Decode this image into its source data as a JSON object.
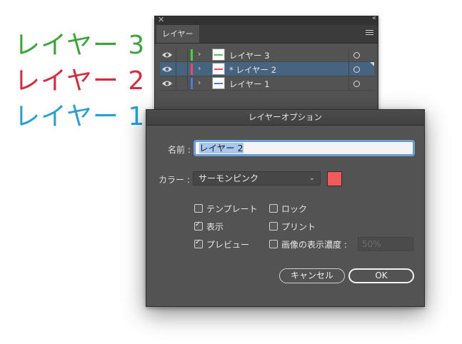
{
  "canvas_labels": [
    {
      "text": "レイヤー 3",
      "color": "#3aa63a"
    },
    {
      "text": "レイヤー 2",
      "color": "#d42d3f"
    },
    {
      "text": "レイヤー 1",
      "color": "#2a9fd6"
    }
  ],
  "panel": {
    "tab_label": "レイヤー",
    "layers": [
      {
        "name": "レイヤー 3",
        "color": "#3cd83c",
        "selected": false
      },
      {
        "name": "* レイヤー 2",
        "color": "#f04a5a",
        "selected": true
      },
      {
        "name": "レイヤー 1",
        "color": "#4a78e8",
        "selected": false
      }
    ]
  },
  "dialog": {
    "title": "レイヤーオプション",
    "name_label": "名前 :",
    "name_value": "レイヤー 2",
    "color_label": "カラー :",
    "color_value": "サーモンピンク",
    "swatch_color": "#f15a5c",
    "options": {
      "template": {
        "label": "テンプレート",
        "checked": false
      },
      "lock": {
        "label": "ロック",
        "checked": false
      },
      "show": {
        "label": "表示",
        "checked": true
      },
      "print": {
        "label": "プリント",
        "checked": false
      },
      "preview": {
        "label": "プレビュー",
        "checked": true
      },
      "dim": {
        "label": "画像の表示濃度 :",
        "checked": false
      }
    },
    "dim_value": "50%",
    "cancel_label": "キャンセル",
    "ok_label": "OK"
  }
}
